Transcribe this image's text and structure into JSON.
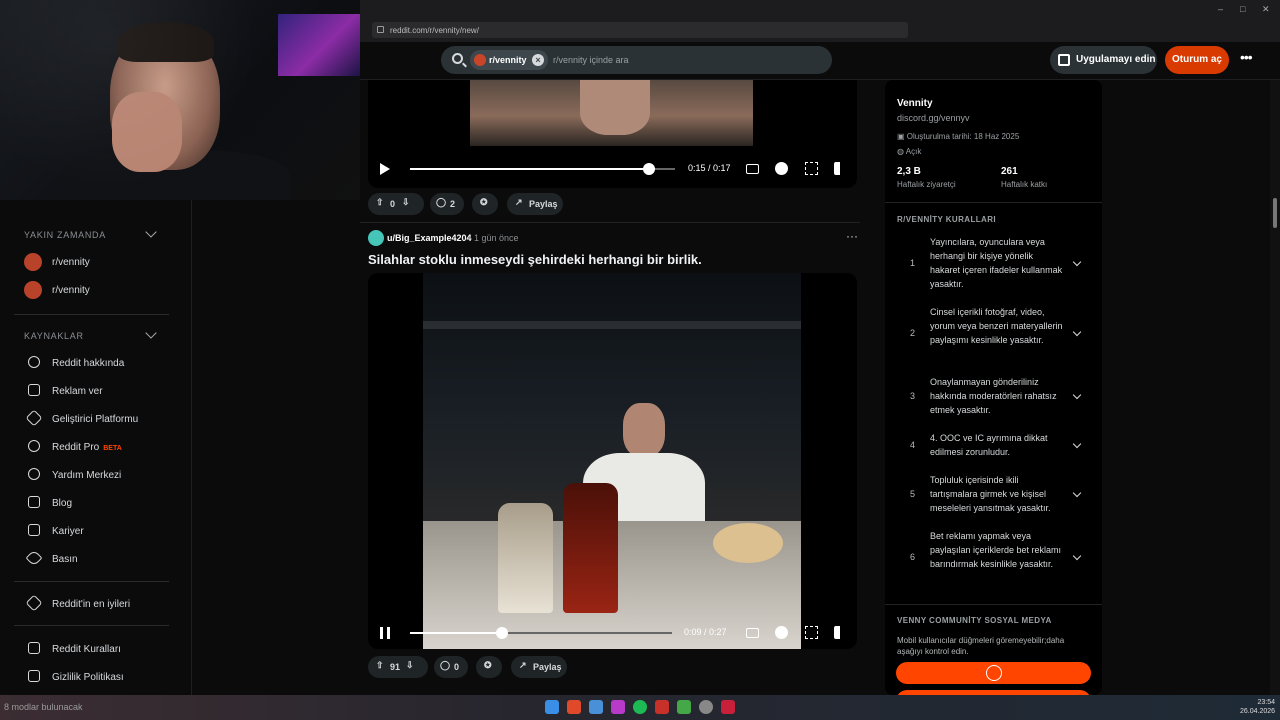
{
  "browser": {
    "url": "reddit.com/r/vennity/new/",
    "window_controls": [
      "–",
      "□",
      "✕"
    ]
  },
  "header": {
    "search_chip": "r/vennity",
    "search_placeholder": "r/vennity içinde ara",
    "get_app": "Uygulamayı edin",
    "login": "Oturum aç",
    "more": "•••"
  },
  "sidebar": {
    "recent_title": "YAKIN ZAMANDA",
    "recent": [
      "r/vennity",
      "r/vennity"
    ],
    "resources_title": "KAYNAKLAR",
    "resources": [
      {
        "label": "Reddit hakkında",
        "icon": "reddit-alien-icon"
      },
      {
        "label": "Reklam ver",
        "icon": "megaphone-icon"
      },
      {
        "label": "Geliştirici Platformu",
        "icon": "developer-platform-icon"
      },
      {
        "label": "Reddit Pro",
        "icon": "pro-icon",
        "badge": "BETA"
      },
      {
        "label": "Yardım Merkezi",
        "icon": "help-icon"
      },
      {
        "label": "Blog",
        "icon": "book-icon"
      },
      {
        "label": "Kariyer",
        "icon": "briefcase-icon"
      },
      {
        "label": "Basın",
        "icon": "press-icon"
      }
    ],
    "best_of": "Reddit'in en iyileri",
    "footer": [
      "Reddit Kuralları",
      "Gizlilik Politikası"
    ]
  },
  "feed": {
    "post1": {
      "time": "0:15 / 0:17",
      "progress": 0.9,
      "votes": "0",
      "comments": "2",
      "share": "Paylaş"
    },
    "post2": {
      "user": "u/Big_Example4204",
      "age": "1 gün önce",
      "title": "Silahlar stoklu inmeseydi şehirdeki herhangi bir birlik.",
      "time": "0:09 / 0:27",
      "progress": 0.35,
      "votes": "91",
      "comments": "0",
      "share": "Paylaş"
    }
  },
  "community": {
    "name": "Vennity",
    "link": "discord.gg/vennyv",
    "created": "Oluşturulma tarihi: 18 Haz 2025",
    "visibility": "Açık",
    "stats": [
      {
        "value": "2,3 B",
        "label": "Haftalık ziyaretçi"
      },
      {
        "value": "261",
        "label": "Haftalık katkı"
      }
    ],
    "rules_title": "R/VENNİTY KURALLARI",
    "rules": [
      {
        "n": "1",
        "text": "Yayıncılara, oyunculara veya herhangi bir kişiye yönelik hakaret içeren ifadeler kullanmak yasaktır."
      },
      {
        "n": "2",
        "text": "Cinsel içerikli fotoğraf, video, yorum veya benzeri materyallerin paylaşımı kesinlikle yasaktır."
      },
      {
        "n": "3",
        "text": "Onaylanmayan gönderiliniz hakkında moderatörleri rahatsız etmek yasaktır."
      },
      {
        "n": "4",
        "text": "4. OOC ve IC ayrımına dikkat edilmesi zorunludur."
      },
      {
        "n": "5",
        "text": "Topluluk içerisinde ikili tartışmalara girmek ve kişisel meseleleri yansıtmak yasaktır."
      },
      {
        "n": "6",
        "text": "Bet reklamı yapmak veya paylaşılan içeriklerde bet reklamı barındırmak kesinlikle yasaktır."
      }
    ],
    "social_title": "VENNY COMMUNİTY SOSYAL MEDYA",
    "social_note": "Mobil kullanıcılar düğmeleri göremeyebilir;daha aşağıyı kontrol edin."
  },
  "taskbar": {
    "overlay_text": "8 modlar bulunacak",
    "clock_time": "23:54",
    "clock_date": "26.04.2026"
  },
  "colors": {
    "accent": "#d93a00",
    "bg": "#0b0b0c"
  }
}
